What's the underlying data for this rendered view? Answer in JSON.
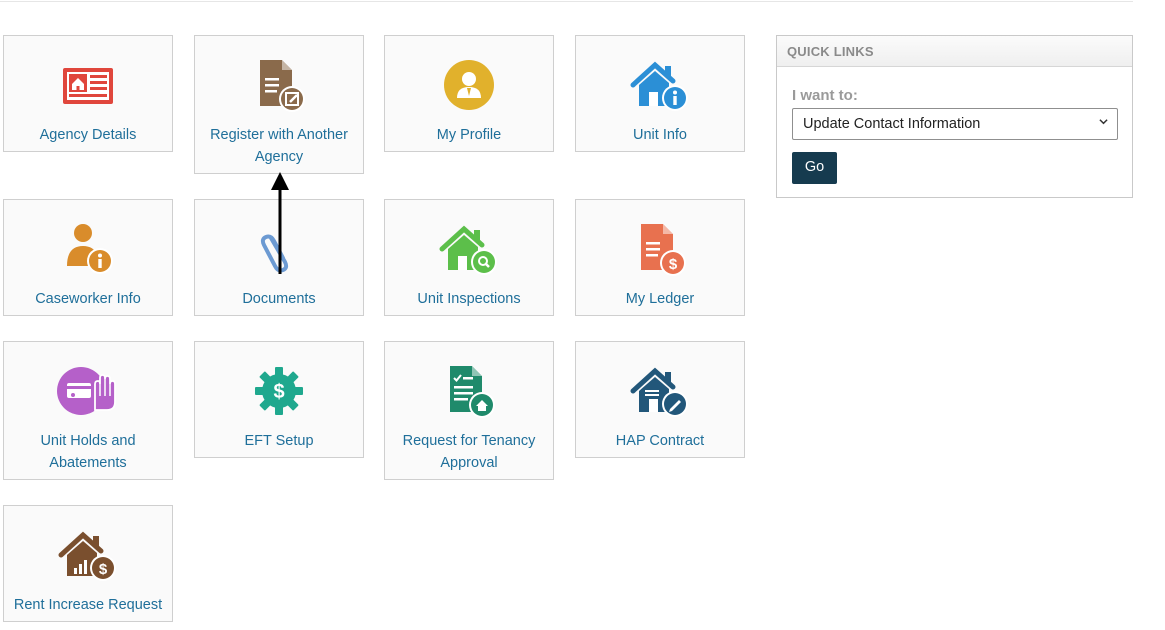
{
  "tiles": [
    {
      "label": "Agency Details",
      "icon": "newspaper-home-icon",
      "color": "#e0463c"
    },
    {
      "label": "Register with Another Agency",
      "icon": "document-edit-icon",
      "color": "#8a6a4b"
    },
    {
      "label": "My Profile",
      "icon": "user-profile-icon",
      "color": "#e1b12c"
    },
    {
      "label": "Unit Info",
      "icon": "house-info-icon",
      "color": "#2b8fd6"
    },
    {
      "label": "Caseworker Info",
      "icon": "person-info-icon",
      "color": "#d98c2b"
    },
    {
      "label": "Documents",
      "icon": "paperclip-icon",
      "color": "#6c9ad2"
    },
    {
      "label": "Unit Inspections",
      "icon": "house-search-icon",
      "color": "#5cbf4a"
    },
    {
      "label": "My Ledger",
      "icon": "document-dollar-icon",
      "color": "#e8714f"
    },
    {
      "label": "Unit Holds and Abatements",
      "icon": "card-hand-stop-icon",
      "color": "#b560c9"
    },
    {
      "label": "EFT Setup",
      "icon": "gear-dollar-icon",
      "color": "#1fa88e"
    },
    {
      "label": "Request for Tenancy Approval",
      "icon": "checklist-house-icon",
      "color": "#1f8a6b"
    },
    {
      "label": "HAP Contract",
      "icon": "house-pen-icon",
      "color": "#22577a"
    },
    {
      "label": "Rent Increase Request",
      "icon": "house-chart-dollar-icon",
      "color": "#7a4f2e"
    }
  ],
  "quick_links": {
    "title": "QUICK LINKS",
    "prompt": "I want to:",
    "selected": "Update Contact Information",
    "go_label": "Go"
  }
}
